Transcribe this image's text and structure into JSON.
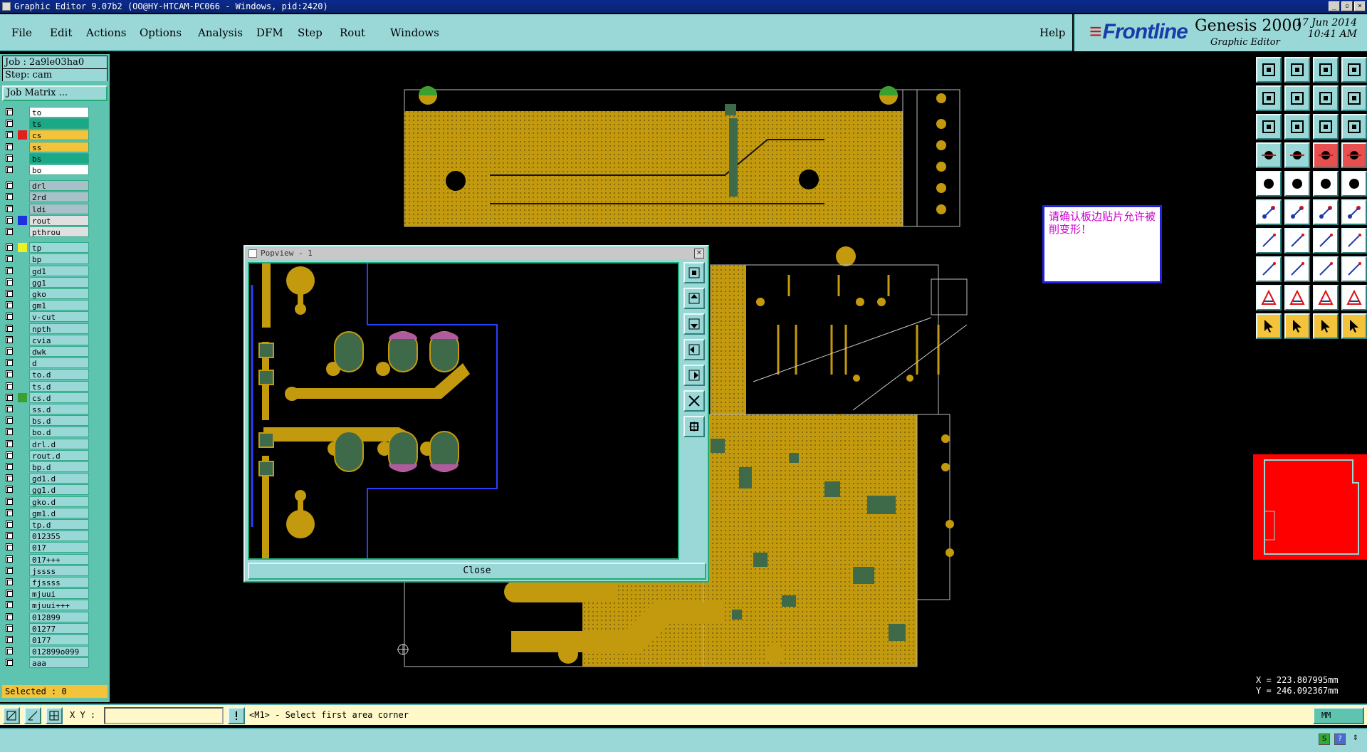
{
  "window": {
    "title": "Graphic Editor 9.07b2 (OO@HY-HTCAM-PC066 - Windows, pid:2420)"
  },
  "menu": {
    "items": [
      "File",
      "Edit",
      "Actions",
      "Options",
      "Analysis",
      "DFM",
      "Step",
      "Rout",
      "Windows"
    ],
    "help": "Help"
  },
  "brand": {
    "logo": "Frontline",
    "product": "Genesis 2000",
    "subtitle": "Graphic Editor",
    "date": "17 Jun 2014",
    "time": "10:41 AM"
  },
  "job": {
    "job": "Job : 2a9le03ha0",
    "step": "Step: cam",
    "matrix_button": "Job Matrix ..."
  },
  "layers": [
    {
      "name": "to",
      "bg": "#ffffff",
      "swatch": ""
    },
    {
      "name": "ts",
      "bg": "#1aa886",
      "swatch": ""
    },
    {
      "name": "cs",
      "bg": "#f2c33b",
      "swatch": "#e02020"
    },
    {
      "name": "ss",
      "bg": "#f2c33b",
      "swatch": ""
    },
    {
      "name": "bs",
      "bg": "#1aa886",
      "swatch": ""
    },
    {
      "name": "bo",
      "bg": "#ffffff",
      "swatch": ""
    },
    {
      "name": "drl",
      "bg": "#a8c0c8",
      "swatch": ""
    },
    {
      "name": "2rd",
      "bg": "#a8c0c8",
      "swatch": ""
    },
    {
      "name": "ldi",
      "bg": "#a8c0c8",
      "swatch": ""
    },
    {
      "name": "rout",
      "bg": "#e0e0e0",
      "swatch": "#2030e0"
    },
    {
      "name": "pthrou",
      "bg": "#e0e0e0",
      "swatch": ""
    },
    {
      "name": "tp",
      "bg": "#9ad8d8",
      "swatch": "#f0f020"
    },
    {
      "name": "bp",
      "bg": "#9ad8d8",
      "swatch": ""
    },
    {
      "name": "gd1",
      "bg": "#9ad8d8",
      "swatch": ""
    },
    {
      "name": "gg1",
      "bg": "#9ad8d8",
      "swatch": ""
    },
    {
      "name": "gko",
      "bg": "#9ad8d8",
      "swatch": ""
    },
    {
      "name": "gm1",
      "bg": "#9ad8d8",
      "swatch": ""
    },
    {
      "name": "v-cut",
      "bg": "#9ad8d8",
      "swatch": ""
    },
    {
      "name": "npth",
      "bg": "#9ad8d8",
      "swatch": ""
    },
    {
      "name": "cvia",
      "bg": "#9ad8d8",
      "swatch": ""
    },
    {
      "name": "dwk",
      "bg": "#9ad8d8",
      "swatch": ""
    },
    {
      "name": "d",
      "bg": "#9ad8d8",
      "swatch": ""
    },
    {
      "name": "to.d",
      "bg": "#9ad8d8",
      "swatch": ""
    },
    {
      "name": "ts.d",
      "bg": "#9ad8d8",
      "swatch": ""
    },
    {
      "name": "cs.d",
      "bg": "#9ad8d8",
      "swatch": "#3aa030"
    },
    {
      "name": "ss.d",
      "bg": "#9ad8d8",
      "swatch": ""
    },
    {
      "name": "bs.d",
      "bg": "#9ad8d8",
      "swatch": ""
    },
    {
      "name": "bo.d",
      "bg": "#9ad8d8",
      "swatch": ""
    },
    {
      "name": "drl.d",
      "bg": "#9ad8d8",
      "swatch": ""
    },
    {
      "name": "rout.d",
      "bg": "#9ad8d8",
      "swatch": ""
    },
    {
      "name": "bp.d",
      "bg": "#9ad8d8",
      "swatch": ""
    },
    {
      "name": "gd1.d",
      "bg": "#9ad8d8",
      "swatch": ""
    },
    {
      "name": "gg1.d",
      "bg": "#9ad8d8",
      "swatch": ""
    },
    {
      "name": "gko.d",
      "bg": "#9ad8d8",
      "swatch": ""
    },
    {
      "name": "gm1.d",
      "bg": "#9ad8d8",
      "swatch": ""
    },
    {
      "name": "tp.d",
      "bg": "#9ad8d8",
      "swatch": ""
    },
    {
      "name": "012355",
      "bg": "#9ad8d8",
      "swatch": ""
    },
    {
      "name": "017",
      "bg": "#9ad8d8",
      "swatch": ""
    },
    {
      "name": "017+++",
      "bg": "#9ad8d8",
      "swatch": ""
    },
    {
      "name": "jssss",
      "bg": "#9ad8d8",
      "swatch": ""
    },
    {
      "name": "fjssss",
      "bg": "#9ad8d8",
      "swatch": ""
    },
    {
      "name": "mjuui",
      "bg": "#9ad8d8",
      "swatch": ""
    },
    {
      "name": "mjuui+++",
      "bg": "#9ad8d8",
      "swatch": ""
    },
    {
      "name": "012899",
      "bg": "#9ad8d8",
      "swatch": ""
    },
    {
      "name": "01277",
      "bg": "#9ad8d8",
      "swatch": ""
    },
    {
      "name": "0177",
      "bg": "#9ad8d8",
      "swatch": ""
    },
    {
      "name": "012899o099",
      "bg": "#9ad8d8",
      "swatch": ""
    },
    {
      "name": "aaa",
      "bg": "#9ad8d8",
      "swatch": ""
    }
  ],
  "selected": "Selected : 0",
  "note": "请确认板边贴片允许被削变形！",
  "popview": {
    "title": "Popview - 1",
    "close_label": "Close"
  },
  "coords": {
    "x": "X = 223.807995mm",
    "y": "Y = 246.092367mm"
  },
  "bottom": {
    "xy_label": "X Y :",
    "xy_value": "",
    "prompt": "<M1> - Select first area corner",
    "units": "MM"
  },
  "colors": {
    "accent": "#9ad8d8",
    "copper": "#c39a0e",
    "pad": "#3f6a4a",
    "board_bg": "#000000"
  }
}
